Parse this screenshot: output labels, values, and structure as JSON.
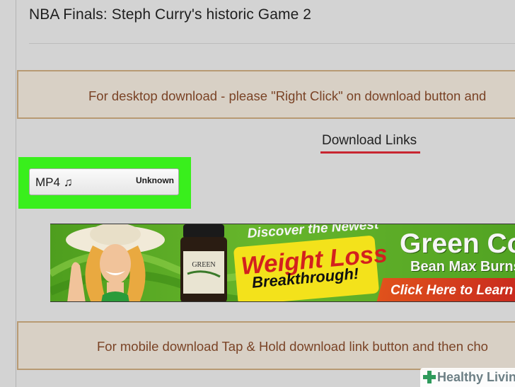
{
  "page": {
    "title": "NBA Finals: Steph Curry's historic Game 2"
  },
  "notices": {
    "desktop": "For desktop download - please \"Right Click\" on download button and",
    "mobile": "For mobile download Tap & Hold download link button and then cho"
  },
  "downloads": {
    "heading": "Download Links",
    "highlight_color": "#39EF1C",
    "items": [
      {
        "format": "MP4",
        "icon": "music-note-icon",
        "size": "Unknown"
      }
    ]
  },
  "ad": {
    "headline": "Discover the Newest",
    "main": "Weight Loss",
    "sub": "Breakthrough!",
    "product": "Green Cof",
    "tagline": "Bean Max Burns",
    "cta": "Click Here to Learn",
    "jar_label": "GREEN"
  },
  "watermark": {
    "text": "Healthy Living",
    "icon": "cross-icon"
  },
  "colors": {
    "background": "#D3D3D3",
    "notice_border": "#B89A73",
    "notice_text": "#7A4326",
    "heading_underline": "#C82530"
  }
}
